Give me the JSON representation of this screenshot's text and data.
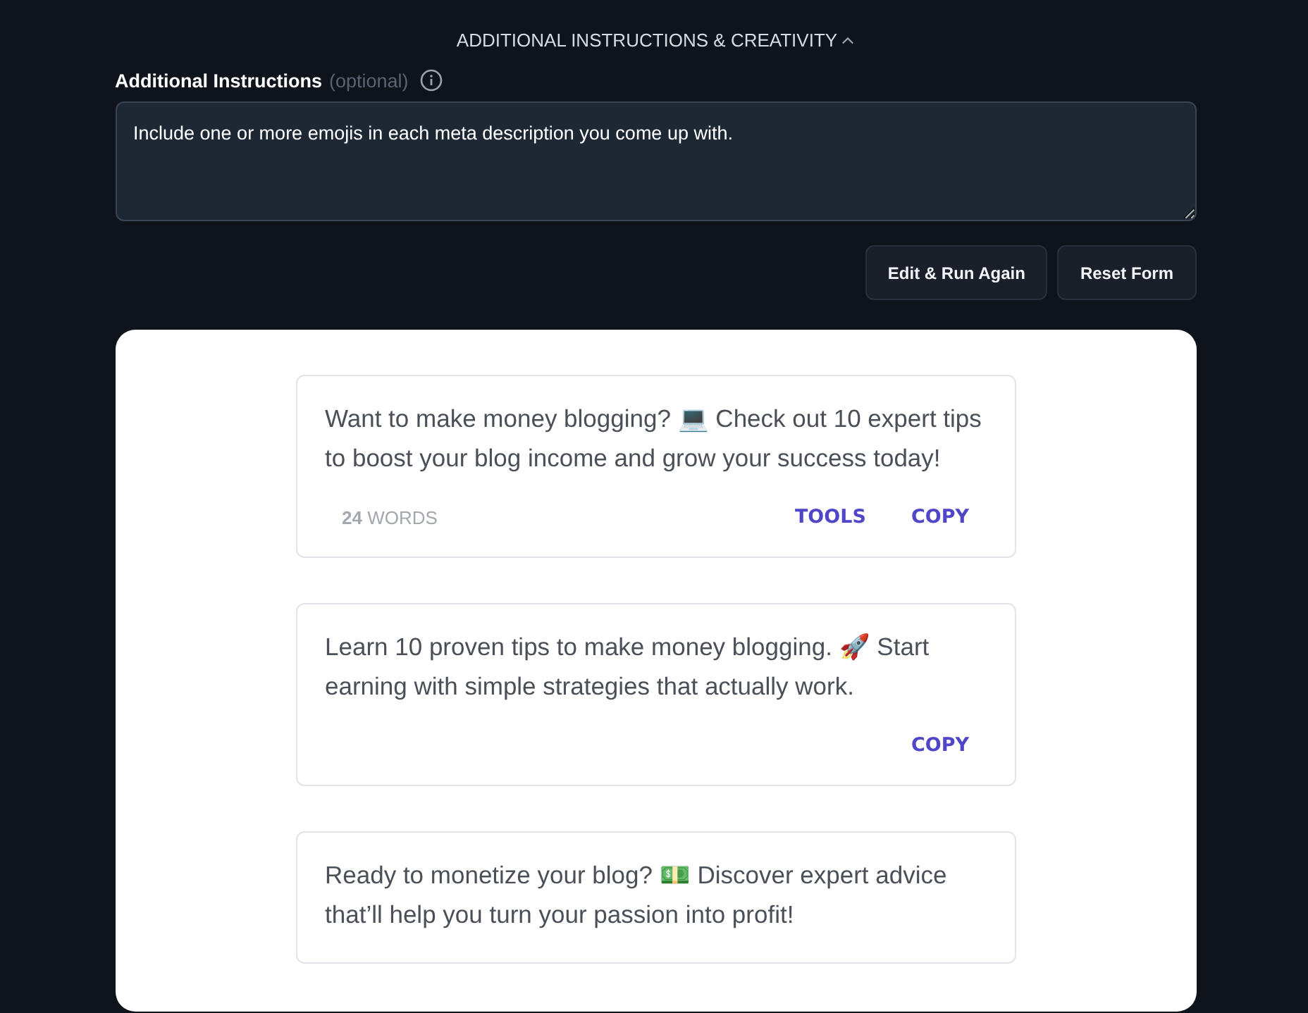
{
  "section_toggle": {
    "label": "ADDITIONAL INSTRUCTIONS & CREATIVITY",
    "expanded": true
  },
  "instructions": {
    "label": "Additional Instructions",
    "hint": "(optional)",
    "value": "Include one or more emojis in each meta description you come up with."
  },
  "buttons": [
    "Edit & Run Again",
    "Reset Form"
  ],
  "results": [
    {
      "text": "Want to make money blogging? 💻 Check out 10 expert tips to boost your blog income and grow your success today!",
      "word_count": "24",
      "word_label": "WORDS",
      "actions": [
        "TOOLS",
        "COPY"
      ]
    },
    {
      "text": "Learn 10 proven tips to make money blogging. 🚀 Start earning with simple strategies that actually work.",
      "actions": [
        "COPY"
      ]
    },
    {
      "text": "Ready to monetize your blog? 💵 Discover expert advice that’ll help you turn your passion into profit!"
    }
  ]
}
